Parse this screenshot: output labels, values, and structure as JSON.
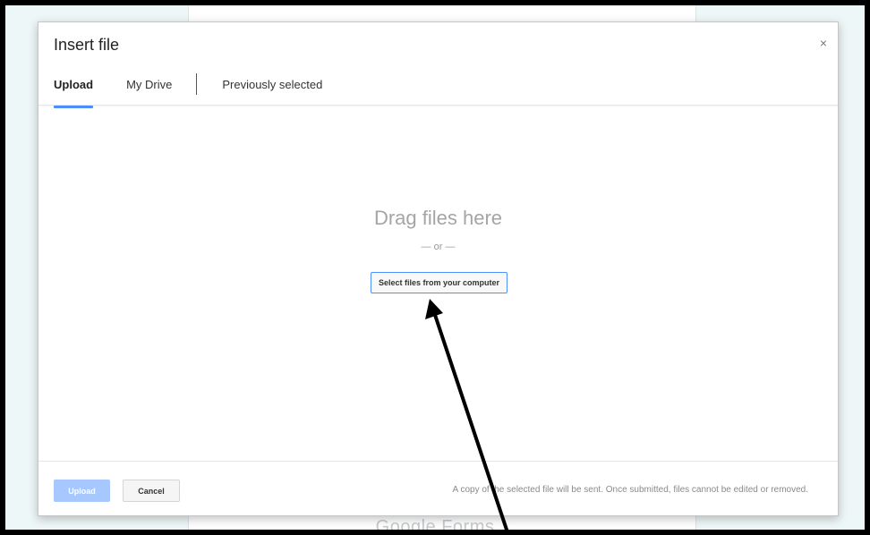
{
  "background": {
    "footer_text": "Google Forms"
  },
  "dialog": {
    "title": "Insert file",
    "close_glyph": "×",
    "tabs": [
      {
        "label": "Upload",
        "active": true
      },
      {
        "label": "My Drive",
        "active": false
      },
      {
        "label": "Previously selected",
        "active": false
      }
    ],
    "drop": {
      "heading": "Drag files here",
      "or_text": "— or —",
      "select_button": "Select files from your computer"
    },
    "footer": {
      "upload_button": "Upload",
      "cancel_button": "Cancel",
      "note": "A copy of the selected file will be sent. Once submitted, files cannot be edited or removed."
    }
  },
  "icons": {
    "close": "close-icon"
  },
  "colors": {
    "accent": "#4d90fe",
    "upload_disabled": "#a6c8ff",
    "annotation_arrow": "#000000"
  }
}
